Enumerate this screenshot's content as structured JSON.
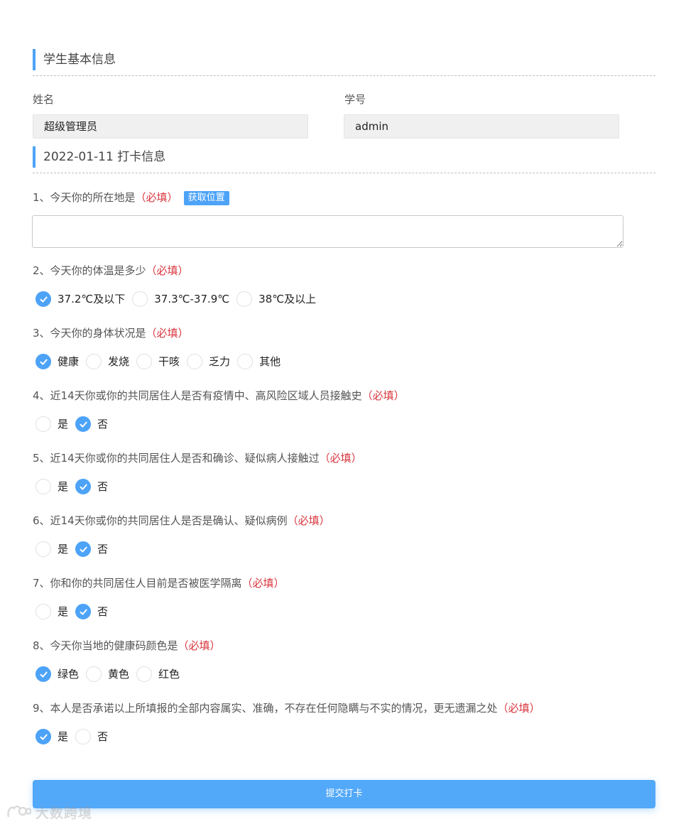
{
  "colors": {
    "accent": "#4da3f7",
    "required": "#d9363e",
    "submit": "#52a8f9"
  },
  "basic_info": {
    "title": "学生基本信息",
    "name_label": "姓名",
    "name_value": "超级管理员",
    "id_label": "学号",
    "id_value": "admin"
  },
  "checkin": {
    "title": "2022-01-11 打卡信息"
  },
  "required_mark": "（必填）",
  "q1": {
    "text": "1、今天你的所在地是",
    "required": "（必填）",
    "locate_button": "获取位置",
    "value": ""
  },
  "questions": [
    {
      "text": "2、今天你的体温是多少",
      "required": "（必填）",
      "options": [
        {
          "label": "37.2℃及以下",
          "checked": true
        },
        {
          "label": "37.3℃-37.9℃",
          "checked": false
        },
        {
          "label": "38℃及以上",
          "checked": false
        }
      ]
    },
    {
      "text": "3、今天你的身体状况是",
      "required": "（必填）",
      "options": [
        {
          "label": "健康",
          "checked": true
        },
        {
          "label": "发烧",
          "checked": false
        },
        {
          "label": "干咳",
          "checked": false
        },
        {
          "label": "乏力",
          "checked": false
        },
        {
          "label": "其他",
          "checked": false
        }
      ]
    },
    {
      "text": "4、近14天你或你的共同居住人是否有疫情中、高风险区域人员接触史",
      "required": "（必填）",
      "options": [
        {
          "label": "是",
          "checked": false
        },
        {
          "label": "否",
          "checked": true
        }
      ]
    },
    {
      "text": "5、近14天你或你的共同居住人是否和确诊、疑似病人接触过",
      "required": "（必填）",
      "options": [
        {
          "label": "是",
          "checked": false
        },
        {
          "label": "否",
          "checked": true
        }
      ]
    },
    {
      "text": "6、近14天你或你的共同居住人是否是确认、疑似病例",
      "required": "（必填）",
      "options": [
        {
          "label": "是",
          "checked": false
        },
        {
          "label": "否",
          "checked": true
        }
      ]
    },
    {
      "text": "7、你和你的共同居住人目前是否被医学隔离",
      "required": "（必填）",
      "options": [
        {
          "label": "是",
          "checked": false
        },
        {
          "label": "否",
          "checked": true
        }
      ]
    },
    {
      "text": "8、今天你当地的健康码颜色是",
      "required": "（必填）",
      "options": [
        {
          "label": "绿色",
          "checked": true
        },
        {
          "label": "黄色",
          "checked": false
        },
        {
          "label": "红色",
          "checked": false
        }
      ]
    },
    {
      "text": "9、本人是否承诺以上所填报的全部内容属实、准确，不存在任何隐瞒与不实的情况，更无遗漏之处",
      "required": "（必填）",
      "options": [
        {
          "label": "是",
          "checked": true
        },
        {
          "label": "否",
          "checked": false
        }
      ]
    }
  ],
  "submit_label": "提交打卡",
  "watermark": {
    "text": "大数跨境",
    "icon": "watermark-logo-icon"
  }
}
